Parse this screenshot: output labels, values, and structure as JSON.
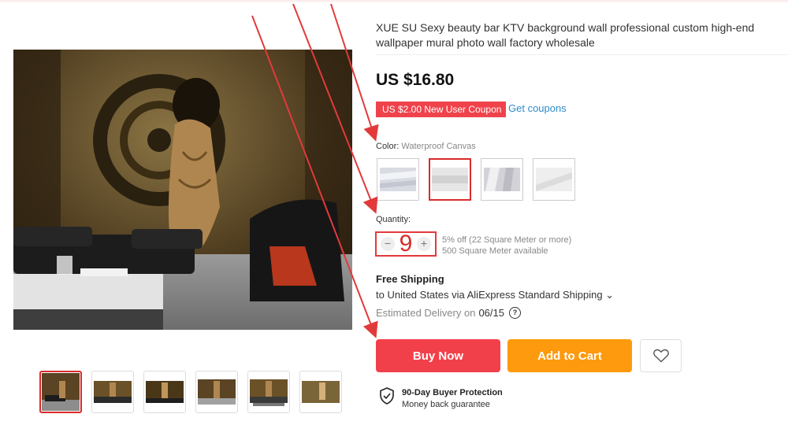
{
  "product": {
    "title": "XUE SU Sexy beauty bar KTV background wall professional custom high-end wallpaper mural photo wall factory wholesale",
    "price": "US $16.80",
    "coupon_badge": "US $2.00 New User Coupon",
    "coupon_link": "Get coupons"
  },
  "color": {
    "label": "Color:",
    "selected_value": "Waterproof Canvas",
    "selected_index": 1
  },
  "quantity": {
    "label": "Quantity:",
    "minus": "−",
    "plus": "+",
    "value": "9",
    "discount_note": "5% off (22 Square Meter or more)",
    "available": "500 Square Meter available"
  },
  "shipping": {
    "title": "Free Shipping",
    "line": "to United States via AliExpress Standard Shipping ⌄",
    "estimated_label": "Estimated Delivery on",
    "estimated_date": "06/15",
    "help_glyph": "?"
  },
  "actions": {
    "buy_now": "Buy Now",
    "add_to_cart": "Add to Cart"
  },
  "protection": {
    "title": "90-Day Buyer Protection",
    "subtitle": "Money back guarantee"
  },
  "thumbnails": {
    "active_index": 0
  },
  "colors": {
    "accent_red": "#f2404b",
    "cart_orange": "#fd9a0d",
    "link_blue": "#2f8bc9",
    "annotation_red": "#e23a3a"
  }
}
